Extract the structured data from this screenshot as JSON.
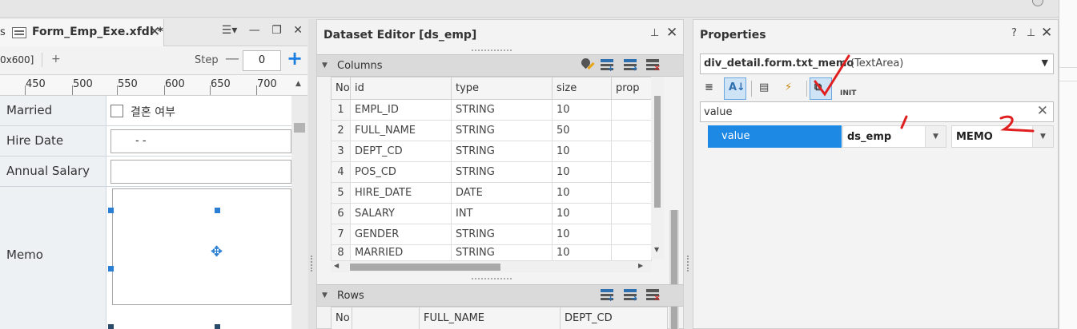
{
  "left_panel": {
    "tab_lead": "s",
    "tab_title": "Form_Emp_Exe.xfdl *",
    "tab_close": "✕",
    "toolbar_icons": {
      "list": "☰▾",
      "minimize": "—",
      "restore": "❐",
      "close": "✕"
    },
    "dim_label": "0x600]",
    "plus_label": "+",
    "step_label": "Step",
    "step_minus": "—",
    "step_value": "0",
    "step_plus": "+",
    "ruler_labels": [
      "450",
      "500",
      "550",
      "600",
      "650",
      "700"
    ],
    "fields": [
      {
        "label": "Married",
        "control_text": "결혼 여부"
      },
      {
        "label": "Hire Date",
        "control_text": "-  -"
      },
      {
        "label": "Annual Salary",
        "control_text": ""
      },
      {
        "label": "Memo",
        "control_text": ""
      }
    ]
  },
  "dataset_editor": {
    "title": "Dataset Editor [ds_emp]",
    "pin": "⊥",
    "close": "✕",
    "columns_section": "Columns",
    "columns_headers": [
      "No",
      "id",
      "type",
      "size",
      "prop"
    ],
    "columns_rows": [
      [
        "1",
        "EMPL_ID",
        "STRING",
        "10",
        ""
      ],
      [
        "2",
        "FULL_NAME",
        "STRING",
        "50",
        ""
      ],
      [
        "3",
        "DEPT_CD",
        "STRING",
        "10",
        ""
      ],
      [
        "4",
        "POS_CD",
        "STRING",
        "10",
        ""
      ],
      [
        "5",
        "HIRE_DATE",
        "DATE",
        "10",
        ""
      ],
      [
        "6",
        "SALARY",
        "INT",
        "10",
        ""
      ],
      [
        "7",
        "GENDER",
        "STRING",
        "10",
        ""
      ],
      [
        "8",
        "MARRIED",
        "STRING",
        "10",
        ""
      ]
    ],
    "rows_section": "Rows",
    "rows_headers": [
      "No",
      "",
      "FULL_NAME",
      "DEPT_CD"
    ]
  },
  "properties": {
    "title": "Properties",
    "help": "?",
    "pin": "⊥",
    "close": "✕",
    "object_name": "div_detail.form.txt_memo",
    "object_type": "(TextArea)",
    "search_value": "value",
    "prop_row": {
      "name": "value",
      "dataset": "ds_emp",
      "column": "MEMO"
    },
    "tool_glyphs": [
      "≡",
      "A↓",
      "▤",
      "⚡",
      "⧉",
      "INIT"
    ]
  },
  "colors": {
    "accent": "#1e88e5",
    "selected_border": "#6aa7df",
    "annotation_red": "#e02020"
  }
}
